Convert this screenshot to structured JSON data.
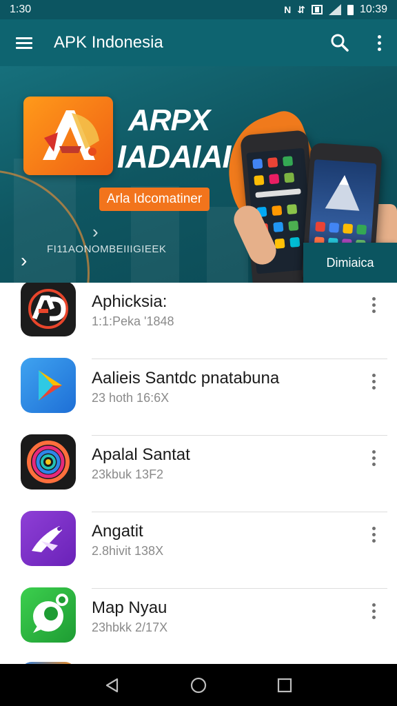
{
  "status_bar": {
    "time": "1:30",
    "right_time": "10:39"
  },
  "app_bar": {
    "title": "APK Indonesia"
  },
  "banner": {
    "headline_line1": "ARPX",
    "headline_line2": "IADAIAI",
    "pill_label": "Arla Idcomatiner",
    "caption": "FI11AONOMBEIIIGIEEK",
    "button_label": "Dimiaica"
  },
  "apps": [
    {
      "name": "Aphicksia:",
      "meta": "1:1:Peka '1848",
      "icon": "ad-logo-icon"
    },
    {
      "name": "Aalieis Santdc pnatabuna",
      "meta": "23 hoth 16:6X",
      "icon": "play-store-icon"
    },
    {
      "name": "Apalal Santat",
      "meta": "23kbuk 13F2",
      "icon": "rainbow-swirl-icon"
    },
    {
      "name": "Angatit",
      "meta": "2.8hivit 138X",
      "icon": "purple-bird-icon"
    },
    {
      "name": "Map Nyau",
      "meta": "23hbkk 2/17X",
      "icon": "green-chat-icon"
    }
  ],
  "colors": {
    "app_bar": "#0e6470",
    "status_bar": "#0c5561",
    "accent_orange": "#f2741c"
  }
}
